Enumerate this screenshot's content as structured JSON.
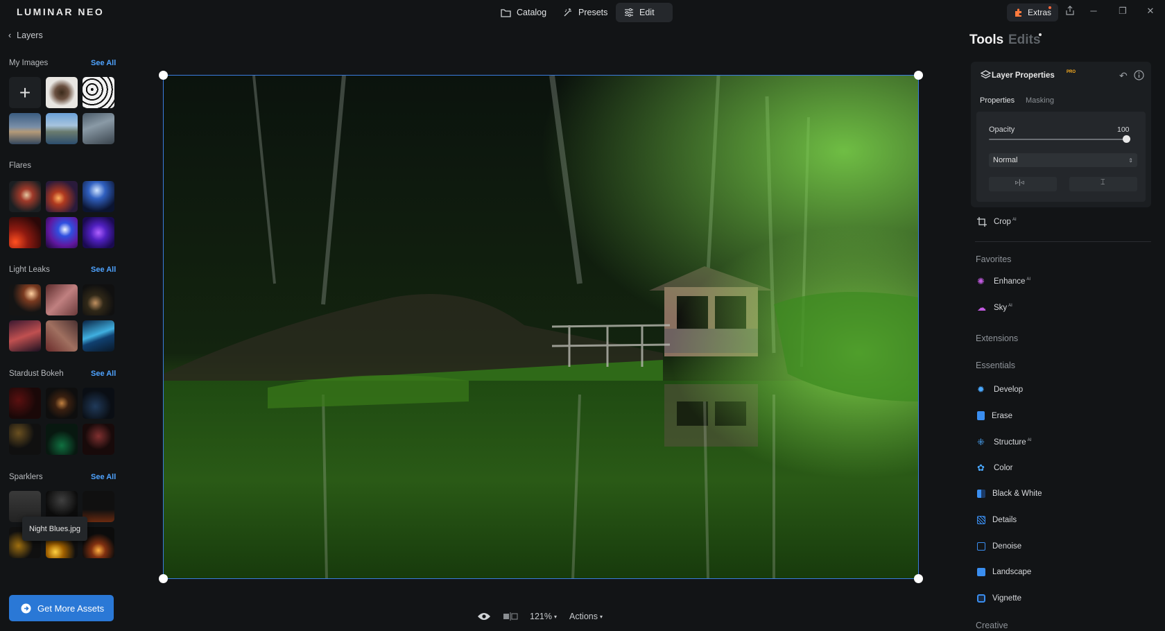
{
  "app": {
    "title": "LUMINAR NEO"
  },
  "nav": {
    "catalog": "Catalog",
    "presets": "Presets",
    "edit": "Edit",
    "extras": "Extras"
  },
  "left": {
    "back_label": "Layers",
    "my_images": "My Images",
    "flares": "Flares",
    "light_leaks": "Light Leaks",
    "stardust_bokeh": "Stardust Bokeh",
    "sparklers": "Sparklers",
    "see_all": "See All",
    "tooltip": "Night Blues.jpg",
    "get_more": "Get More Assets"
  },
  "bottom": {
    "zoom": "121%",
    "actions": "Actions"
  },
  "right": {
    "tab_tools": "Tools",
    "tab_edits": "Edits",
    "layer_props": "Layer Properties",
    "pro": "PRO",
    "tab_properties": "Properties",
    "tab_masking": "Masking",
    "opacity_label": "Opacity",
    "opacity_value": "100",
    "blend_mode": "Normal",
    "crop": "Crop",
    "ai": "AI",
    "favorites": "Favorites",
    "enhance": "Enhance",
    "sky": "Sky",
    "extensions": "Extensions",
    "essentials": "Essentials",
    "develop": "Develop",
    "erase": "Erase",
    "structure": "Structure",
    "color": "Color",
    "bw": "Black & White",
    "details": "Details",
    "denoise": "Denoise",
    "landscape": "Landscape",
    "vignette": "Vignette",
    "creative": "Creative"
  },
  "colors": {
    "accent": "#2a78d6",
    "link": "#4fa3ff",
    "selection": "#3b7de0",
    "badge": "#ff6a3d"
  }
}
